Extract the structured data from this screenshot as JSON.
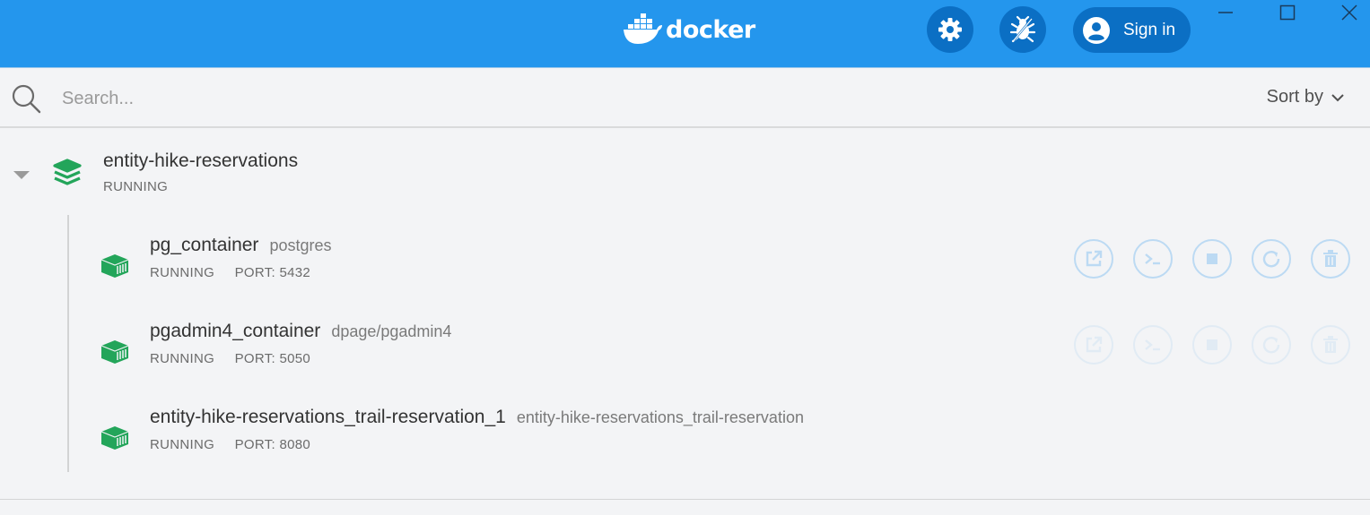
{
  "header": {
    "logo_text": "docker",
    "signin_label": "Sign in",
    "icons": [
      "settings-icon",
      "bug-report-icon",
      "account-icon"
    ],
    "window_controls": [
      "minimize-icon",
      "maximize-icon",
      "close-icon"
    ],
    "colors": {
      "bar": "#2496ed",
      "button": "#0b6fc4"
    }
  },
  "search": {
    "placeholder": "Search...",
    "value": "",
    "sort_label": "Sort by"
  },
  "app": {
    "name": "entity-hike-reservations",
    "status": "RUNNING",
    "accent_color": "#23a55a",
    "containers": [
      {
        "name": "pg_container",
        "image": "postgres",
        "status": "RUNNING",
        "port": "PORT: 5432"
      },
      {
        "name": "pgadmin4_container",
        "image": "dpage/pgadmin4",
        "status": "RUNNING",
        "port": "PORT: 5050"
      },
      {
        "name": "entity-hike-reservations_trail-reservation_1",
        "image": "entity-hike-reservations_trail-reservation",
        "status": "RUNNING",
        "port": "PORT: 8080"
      }
    ]
  },
  "row_actions": [
    "open-in-browser-icon",
    "cli-icon",
    "stop-icon",
    "restart-icon",
    "delete-icon"
  ]
}
